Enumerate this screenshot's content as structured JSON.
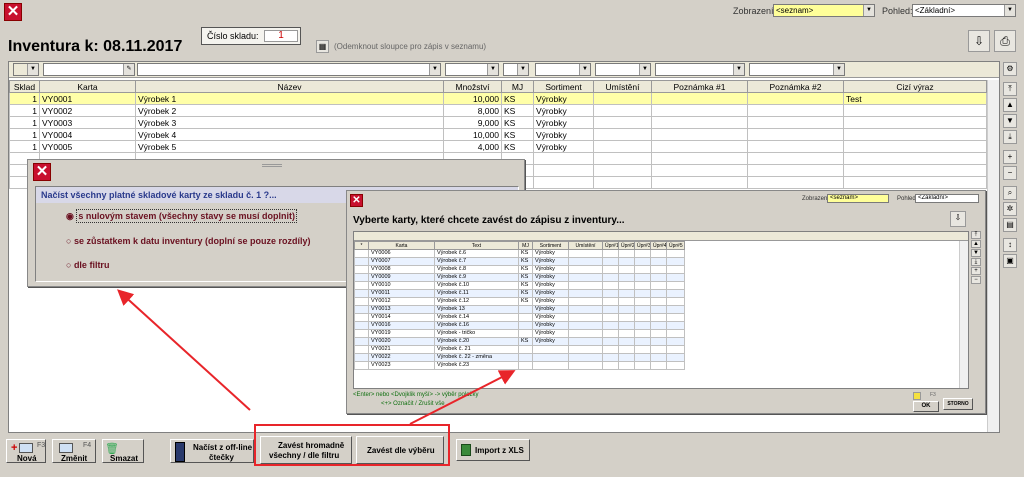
{
  "title_prefix": "Inventura k: ",
  "title_date": "08.11.2017",
  "warehouse_label": "Číslo skladu:",
  "warehouse_value": "1",
  "unlock_hint": "(Odemknout sloupce pro zápis v seznamu)",
  "view_label": "Zobrazení:",
  "view_value": "<seznam>",
  "pohled_label": "Pohled:",
  "pohled_value": "<Základní>",
  "columns": [
    "Sklad",
    "Karta",
    "Název",
    "Množství",
    "MJ",
    "Sortiment",
    "Umístění",
    "Poznámka #1",
    "Poznámka #2",
    "Cizí výraz"
  ],
  "rows": [
    [
      "1",
      "VY0001",
      "Výrobek 1",
      "10,000",
      "KS",
      "Výrobky",
      "",
      "",
      "",
      "Test"
    ],
    [
      "1",
      "VY0002",
      "Výrobek 2",
      "8,000",
      "KS",
      "Výrobky",
      "",
      "",
      "",
      ""
    ],
    [
      "1",
      "VY0003",
      "Výrobek 3",
      "9,000",
      "KS",
      "Výrobky",
      "",
      "",
      "",
      ""
    ],
    [
      "1",
      "VY0004",
      "Výrobek 4",
      "10,000",
      "KS",
      "Výrobky",
      "",
      "",
      "",
      ""
    ],
    [
      "1",
      "VY0005",
      "Výrobek 5",
      "4,000",
      "KS",
      "Výrobky",
      "",
      "",
      "",
      ""
    ]
  ],
  "dialog1": {
    "question": "Načíst všechny platné skladové karty ze skladu č. 1 ?...",
    "opt1": "s nulovým stavem (všechny stavy se musí doplnit)",
    "opt2": "se zůstatkem k datu inventury (doplní se pouze rozdíly)",
    "opt3": "dle filtru"
  },
  "dialog2": {
    "view_label": "Zobrazení:",
    "view_value": "<seznam>",
    "pohled_label": "Pohled:",
    "pohled_value": "<Základní>",
    "heading": "Vyberte karty, které chcete zavést do zápisu z inventury...",
    "columns": [
      "*",
      "Karta",
      "Text",
      "MJ",
      "Sortiment",
      "Umístění",
      "Úpr#1",
      "Úpr#2",
      "Úpr#3",
      "Úpr#4",
      "Úpr#5"
    ],
    "rows": [
      [
        "VY0006",
        "Výrobek č.6",
        "KS",
        "Výrobky"
      ],
      [
        "VY0007",
        "Výrobek č.7",
        "KS",
        "Výrobky"
      ],
      [
        "VY0008",
        "Výrobek č.8",
        "KS",
        "Výrobky"
      ],
      [
        "VY0009",
        "Výrobek č.9",
        "KS",
        "Výrobky"
      ],
      [
        "VY0010",
        "Výrobek č.10",
        "KS",
        "Výrobky"
      ],
      [
        "VY0011",
        "Výrobek č.11",
        "KS",
        "Výrobky"
      ],
      [
        "VY0012",
        "Výrobek č.12",
        "KS",
        "Výrobky"
      ],
      [
        "VY0013",
        "Výrobek 13",
        "",
        "Výrobky"
      ],
      [
        "VY0014",
        "Výrobek č.14",
        "",
        "Výrobky"
      ],
      [
        "VY0016",
        "Výrobek č.16",
        "",
        "Výrobky"
      ],
      [
        "VY0019",
        "Výrobek - tričko",
        "",
        "Výrobky"
      ],
      [
        "VY0020",
        "Výrobek č.20",
        "KS",
        "Výrobky"
      ],
      [
        "VY0021",
        "Výrobek č. 21",
        "",
        ""
      ],
      [
        "VY0022",
        "Výrobek č. 22 - změna",
        "",
        ""
      ],
      [
        "VY0023",
        "Výrobek č.23",
        "",
        ""
      ]
    ],
    "hint1": "<Enter> nebo <Dvojklik myší> -> výběr položky",
    "hint2": "<+> Označit / Zrušit vše",
    "f3": "F3",
    "ok": "OK",
    "stop": "STORNO"
  },
  "toolbar": {
    "new_key": "F3",
    "new_label": "Nová",
    "edit_key": "F4",
    "edit_label": "Změnit",
    "del_label": "Smazat",
    "offline_l1": "Načíst z off-line",
    "offline_l2": "čtečky",
    "mass_l1": "Zavést hromadně",
    "mass_l2": "všechny / dle filtru",
    "select_label": "Zavést dle výběru",
    "import_label": "Import z XLS"
  }
}
